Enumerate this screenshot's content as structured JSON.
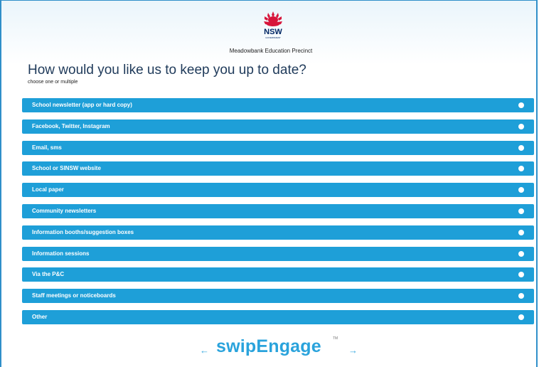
{
  "header": {
    "logo_text": "NSW",
    "logo_subtext": "GOVERNMENT",
    "logo_icon": "waratah-flower-icon",
    "organization": "Meadowbank Education Precinct"
  },
  "question": {
    "title": "How would you like us to keep you up to date?",
    "hint": "choose one or multiple"
  },
  "options": [
    {
      "label": "School newsletter (app or hard copy)",
      "selected": false
    },
    {
      "label": "Facebook, Twitter, Instagram",
      "selected": false
    },
    {
      "label": "Email, sms",
      "selected": false
    },
    {
      "label": "School or SINSW website",
      "selected": false
    },
    {
      "label": "Local paper",
      "selected": false
    },
    {
      "label": "Community newsletters",
      "selected": false
    },
    {
      "label": "Information booths/suggestion boxes",
      "selected": false
    },
    {
      "label": "Information sessions",
      "selected": false
    },
    {
      "label": "Via the P&C",
      "selected": false
    },
    {
      "label": "Staff meetings or noticeboards",
      "selected": false
    },
    {
      "label": "Other",
      "selected": false
    }
  ],
  "footer": {
    "prev_arrow": "←",
    "next_arrow": "→",
    "brand": "swipEngage",
    "trademark": "TM"
  },
  "colors": {
    "option_bg": "#1e9fd8",
    "brand": "#2aa3dc",
    "title": "#1f3a5a",
    "frame_border": "#2f8fc9",
    "logo_red": "#d7153a",
    "logo_navy": "#002664"
  }
}
